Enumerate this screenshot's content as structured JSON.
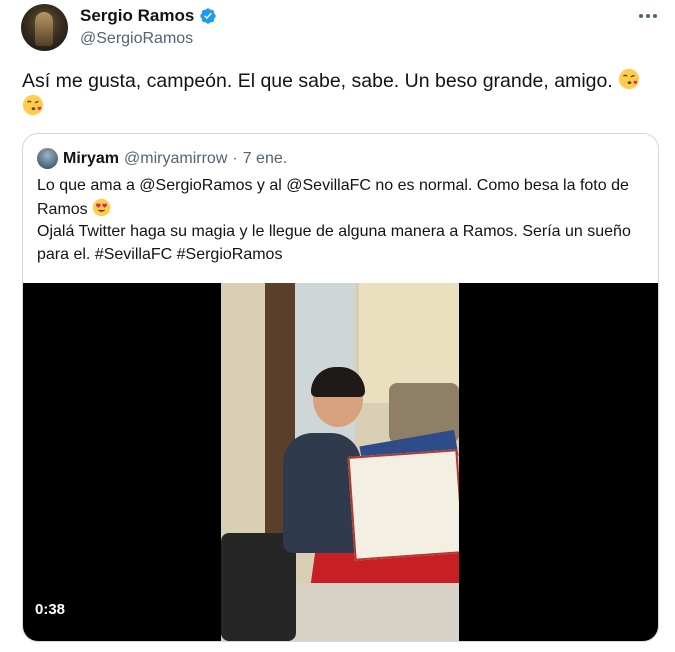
{
  "tweet": {
    "display_name": "Sergio Ramos",
    "handle": "@SergioRamos",
    "verified": true,
    "more_icon": "ellipsis-icon",
    "text": "Así me gusta, campeón. El que sabe, sabe. Un beso grande, amigo.",
    "emoji": "face-blowing-a-kiss"
  },
  "quoted_tweet": {
    "display_name": "Miryam",
    "handle": "@miryamirrow",
    "separator": "·",
    "date": "7 ene.",
    "line1": "Lo que ama a @SergioRamos y al @SevillaFC no es normal. Como besa la foto de Ramos",
    "line1_emoji": "smiling-face-with-heart-eyes",
    "line2": "Ojalá Twitter haga su magia y le llegue de alguna manera a Ramos. Sería un sueño para el. #SevillaFC #SergioRamos",
    "video": {
      "duration": "0:38"
    }
  },
  "colors": {
    "verified": "#1d9bf0",
    "secondary_text": "#536471",
    "border": "#cfd9de"
  }
}
